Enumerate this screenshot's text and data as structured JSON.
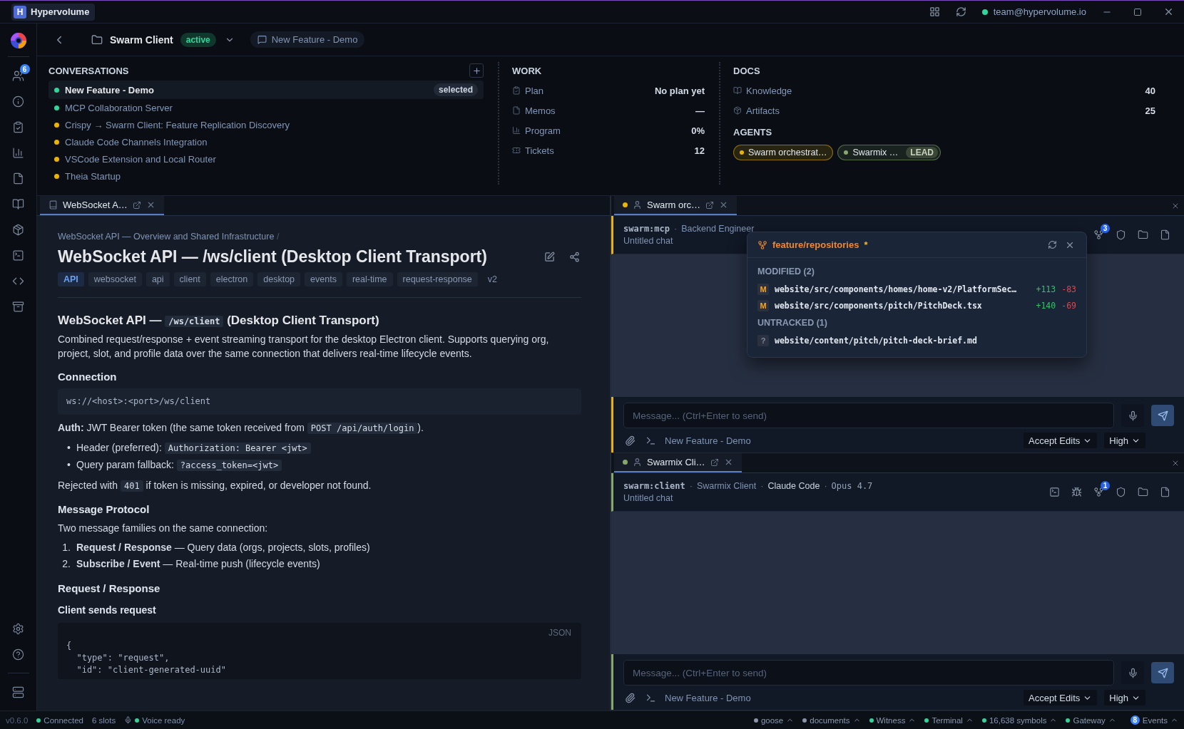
{
  "titlebar": {
    "logo_letter": "H",
    "app_name": "Hypervolume",
    "account": "team@hypervolume.io",
    "online": true
  },
  "rail": {
    "top": [
      {
        "kind": "users",
        "badge": "6"
      },
      {
        "kind": "info"
      },
      {
        "kind": "clipboard"
      },
      {
        "kind": "chart"
      },
      {
        "kind": "file"
      },
      {
        "kind": "book"
      },
      {
        "kind": "box"
      },
      {
        "kind": "terminal"
      },
      {
        "kind": "code"
      },
      {
        "kind": "archive"
      }
    ],
    "bottom": [
      {
        "kind": "settings"
      },
      {
        "kind": "help"
      },
      {
        "kind": "server"
      }
    ]
  },
  "project": {
    "name": "Swarm Client",
    "status": "active",
    "conversation": "New Feature - Demo"
  },
  "conversations": {
    "title": "CONVERSATIONS",
    "items": [
      {
        "label": "New Feature - Demo",
        "color": "#34d399",
        "selected": true,
        "tag": "selected"
      },
      {
        "label": "MCP Collaboration Server",
        "color": "#34d399",
        "selected": false
      },
      {
        "label": "Crispy → Swarm Client: Feature Replication Discovery",
        "color": "#eab308",
        "selected": false
      },
      {
        "label": "Claude Code Channels Integration",
        "color": "#eab308",
        "selected": false
      },
      {
        "label": "VSCode Extension and Local Router",
        "color": "#eab308",
        "selected": false
      },
      {
        "label": "Theia Startup",
        "color": "#eab308",
        "selected": false
      }
    ]
  },
  "work": {
    "title": "WORK",
    "items": [
      {
        "kind": "clipboard",
        "label": "Plan",
        "value": "No plan yet"
      },
      {
        "kind": "file",
        "label": "Memos",
        "value": "—"
      },
      {
        "kind": "chart",
        "label": "Program",
        "value": "0%"
      },
      {
        "kind": "ticket",
        "label": "Tickets",
        "value": "12"
      }
    ]
  },
  "docs": {
    "title": "DOCS",
    "items": [
      {
        "kind": "book",
        "label": "Knowledge",
        "value": "40"
      },
      {
        "kind": "box",
        "label": "Artifacts",
        "value": "25"
      }
    ]
  },
  "agents": {
    "title": "AGENTS",
    "items": [
      {
        "label": "Swarm orchestrat…",
        "color": "#eab308"
      },
      {
        "label": "Swarmix …",
        "color": "#86a86b",
        "badge": "LEAD"
      }
    ]
  },
  "doc": {
    "tab": {
      "title": "WebSocket A…",
      "selected": true
    },
    "breadcrumb": "WebSocket API — Overview and Shared Infrastructure",
    "separator": "/",
    "title": "WebSocket API — /ws/client (Desktop Client Transport)",
    "tags": [
      {
        "label": "API",
        "kind": "primary"
      },
      {
        "label": "websocket",
        "kind": "tag"
      },
      {
        "label": "api",
        "kind": "tag"
      },
      {
        "label": "client",
        "kind": "tag"
      },
      {
        "label": "electron",
        "kind": "tag"
      },
      {
        "label": "desktop",
        "kind": "tag"
      },
      {
        "label": "events",
        "kind": "tag"
      },
      {
        "label": "real-time",
        "kind": "tag"
      },
      {
        "label": "request-response",
        "kind": "tag"
      },
      {
        "label": "v2",
        "kind": "version"
      }
    ],
    "blocks": [
      {
        "kind": "h2",
        "parts": [
          {
            "text": "WebSocket API — "
          },
          {
            "code": "/ws/client"
          },
          {
            "text": " (Desktop Client Transport)"
          }
        ]
      },
      {
        "kind": "p",
        "parts": [
          {
            "text": "Combined request/response + event streaming transport for the desktop Electron client. Supports querying org, project, slot, and profile data over the same connection that delivers real-time lifecycle events."
          }
        ]
      },
      {
        "kind": "h3",
        "parts": [
          {
            "text": "Connection"
          }
        ]
      },
      {
        "kind": "code",
        "lines": [
          "ws://<host>:<port>/ws/client"
        ]
      },
      {
        "kind": "p",
        "parts": [
          {
            "text": "**Auth:** JWT Bearer token (the same token received from "
          },
          {
            "code": "POST /api/auth/login"
          },
          {
            "text": ")."
          }
        ]
      },
      {
        "kind": "list",
        "items": [
          {
            "marker": "•",
            "parts": [
              {
                "text": "Header (preferred): "
              },
              {
                "code": "Authorization: Bearer <jwt>"
              }
            ]
          },
          {
            "marker": "•",
            "parts": [
              {
                "text": "Query param fallback: "
              },
              {
                "code": "?access_token=<jwt>"
              }
            ]
          }
        ]
      },
      {
        "kind": "p",
        "parts": [
          {
            "text": "Rejected with "
          },
          {
            "code": "401"
          },
          {
            "text": " if token is missing, expired, or developer not found."
          }
        ]
      },
      {
        "kind": "h3",
        "parts": [
          {
            "text": "Message Protocol"
          }
        ]
      },
      {
        "kind": "p",
        "parts": [
          {
            "text": "Two message families on the same connection:"
          }
        ]
      },
      {
        "kind": "list",
        "items": [
          {
            "marker": "1.",
            "parts": [
              {
                "text": "**Request / Response** — Query data (orgs, projects, slots, profiles)"
              }
            ]
          },
          {
            "marker": "2.",
            "parts": [
              {
                "text": "**Subscribe / Event** — Real-time push (lifecycle events)"
              }
            ]
          }
        ]
      },
      {
        "kind": "h3",
        "parts": [
          {
            "text": "Request / Response"
          }
        ]
      },
      {
        "kind": "h4",
        "parts": [
          {
            "text": "Client sends request"
          }
        ]
      },
      {
        "kind": "code",
        "lang": "JSON",
        "lines": [
          "{",
          "  \"type\": \"request\",",
          "  \"id\": \"client-generated-uuid\""
        ]
      }
    ]
  },
  "chats": [
    {
      "tab": {
        "title": "Swarm orc…",
        "color": "#eab308",
        "selected": true
      },
      "separator": "·",
      "slug": "swarm:mcp",
      "meta": [
        {
          "text": "Backend Engineer",
          "kind": "plain"
        }
      ],
      "subtitle": "Untitled chat",
      "tools": [
        {
          "kind": "branch",
          "badge": "3"
        },
        {
          "kind": "shield"
        },
        {
          "kind": "folder"
        },
        {
          "kind": "file"
        }
      ],
      "placeholder": "Message... (Ctrl+Enter to send)",
      "context": "New Feature - Demo",
      "mode": "Accept Edits",
      "effort": "High",
      "popover": {
        "branch": "feature/repositories",
        "dirty": "*",
        "groups": [
          {
            "title": "MODIFIED (2)",
            "files": [
              {
                "status": "M",
                "path": "website/src/components/homes/home-v2/PlatformSec…",
                "added": "+113",
                "removed": "-83"
              },
              {
                "status": "M",
                "path": "website/src/components/pitch/PitchDeck.tsx",
                "added": "+140",
                "removed": "-69"
              }
            ]
          },
          {
            "title": "UNTRACKED (1)",
            "files": [
              {
                "status": "?",
                "path": "website/content/pitch/pitch-deck-brief.md"
              }
            ]
          }
        ]
      }
    },
    {
      "tab": {
        "title": "Swarmix Cli…",
        "color": "#86a86b",
        "selected": true
      },
      "separator": "·",
      "slug": "swarm:client",
      "meta": [
        {
          "text": "Swarmix Client",
          "kind": "plain"
        },
        {
          "text": "Claude Code",
          "kind": "strong"
        },
        {
          "text": "Opus 4.7",
          "kind": "mono"
        }
      ],
      "subtitle": "Untitled chat",
      "tools": [
        {
          "kind": "terminal"
        },
        {
          "kind": "bug"
        },
        {
          "kind": "branch",
          "badge": "1"
        },
        {
          "kind": "shield"
        },
        {
          "kind": "folder"
        },
        {
          "kind": "file"
        }
      ],
      "placeholder": "Message... (Ctrl+Enter to send)",
      "context": "New Feature - Demo",
      "mode": "Accept Edits",
      "effort": "High"
    }
  ],
  "status_bar": {
    "version": "v0.6.0",
    "connection": "Connected",
    "slots": "6 slots",
    "voice": "Voice ready",
    "services": [
      {
        "label": "goose",
        "color": "#8b95a7"
      },
      {
        "label": "documents",
        "color": "#8b95a7"
      },
      {
        "label": "Witness",
        "color": "#34d399"
      },
      {
        "label": "Terminal",
        "color": "#34d399"
      },
      {
        "label": "16,638 symbols",
        "color": "#34d399"
      },
      {
        "label": "Gateway",
        "color": "#34d399"
      }
    ],
    "events": {
      "count": "8",
      "label": "Events"
    }
  }
}
